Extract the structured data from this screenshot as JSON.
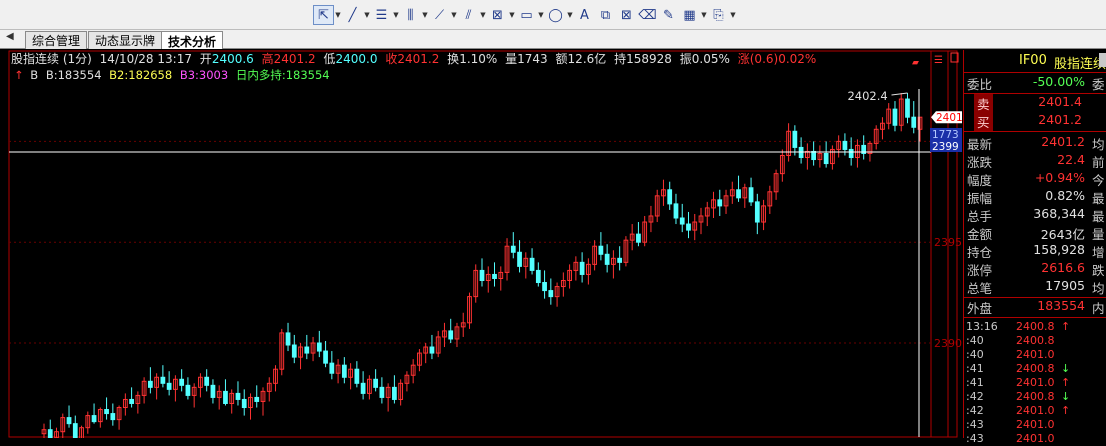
{
  "toolbar": {
    "icons": [
      "cursor-icon",
      "line-icon",
      "text-lines-icon",
      "bar-lines-icon",
      "fan-lines-icon",
      "channel-icon",
      "gann-icon",
      "rectangle-icon",
      "ellipse-icon",
      "text-icon",
      "copy-icon",
      "delete-icon",
      "eraser-icon",
      "note-icon",
      "color-grid-icon",
      "stamp-icon"
    ]
  },
  "tabs": [
    "综合管理",
    "动态显示牌",
    "技术分析"
  ],
  "header": {
    "title": "股指连续",
    "period": "(1分)",
    "datetime": "14/10/28 13:17",
    "open_label": "开",
    "open": "2400.6",
    "high_label": "高",
    "high": "2401.2",
    "low_label": "低",
    "low": "2400.0",
    "close_label": "收",
    "close": "2401.2",
    "turnover_label": "换",
    "turnover": "1.10%",
    "volume_label": "量",
    "volume": "1743",
    "amount_label": "额",
    "amount": "12.6亿",
    "holding_label": "持",
    "holding": "158928",
    "amplitude_label": "振",
    "amplitude": "0.05%",
    "change_label": "涨",
    "change": "(0.6)0.02%"
  },
  "indicator": {
    "arrow": "↑",
    "b_label": "B",
    "b": "B:183554",
    "b2": "B2:182658",
    "b3": "B3:3003",
    "intraday": "日内多持:183554"
  },
  "chart_data": {
    "type": "candlestick",
    "title": "股指连续 (1分)",
    "y_ticks": [
      "2395",
      "2390"
    ],
    "max_label": "2402.4",
    "right_markers": [
      "2401",
      "1773",
      "2399"
    ],
    "up_color": "#ff3232",
    "down_color": "#54ffff",
    "candles": [
      [
        2385.5,
        2386.0,
        2384.8,
        2385.7
      ],
      [
        2385.7,
        2386.2,
        2385.1,
        2385.3
      ],
      [
        2385.3,
        2385.8,
        2384.9,
        2385.6
      ],
      [
        2385.6,
        2386.5,
        2385.2,
        2386.3
      ],
      [
        2386.3,
        2386.9,
        2385.8,
        2386.0
      ],
      [
        2386.0,
        2386.4,
        2385.0,
        2385.2
      ],
      [
        2385.2,
        2385.9,
        2384.8,
        2385.8
      ],
      [
        2385.8,
        2386.6,
        2385.5,
        2386.4
      ],
      [
        2386.4,
        2387.0,
        2386.0,
        2386.1
      ],
      [
        2386.1,
        2386.8,
        2385.8,
        2386.7
      ],
      [
        2386.7,
        2387.3,
        2386.2,
        2386.5
      ],
      [
        2386.5,
        2387.0,
        2385.9,
        2386.2
      ],
      [
        2386.2,
        2386.9,
        2385.7,
        2386.8
      ],
      [
        2386.8,
        2387.5,
        2386.4,
        2387.2
      ],
      [
        2387.2,
        2387.8,
        2386.8,
        2387.0
      ],
      [
        2387.0,
        2387.6,
        2386.5,
        2387.4
      ],
      [
        2387.4,
        2388.3,
        2387.0,
        2388.1
      ],
      [
        2388.1,
        2388.8,
        2387.5,
        2387.8
      ],
      [
        2387.8,
        2388.5,
        2387.2,
        2388.3
      ],
      [
        2388.3,
        2388.9,
        2387.8,
        2388.0
      ],
      [
        2388.0,
        2388.6,
        2387.4,
        2387.7
      ],
      [
        2387.7,
        2388.4,
        2387.1,
        2388.2
      ],
      [
        2388.2,
        2388.7,
        2387.6,
        2387.9
      ],
      [
        2387.9,
        2388.3,
        2387.2,
        2387.4
      ],
      [
        2387.4,
        2388.0,
        2386.8,
        2387.8
      ],
      [
        2387.8,
        2388.5,
        2387.3,
        2388.3
      ],
      [
        2388.3,
        2388.7,
        2387.6,
        2387.9
      ],
      [
        2387.9,
        2388.2,
        2387.0,
        2387.3
      ],
      [
        2387.3,
        2387.9,
        2386.7,
        2387.6
      ],
      [
        2387.6,
        2388.2,
        2386.9,
        2387.0
      ],
      [
        2387.0,
        2387.7,
        2386.5,
        2387.5
      ],
      [
        2387.5,
        2388.1,
        2386.9,
        2387.2
      ],
      [
        2387.2,
        2387.7,
        2386.4,
        2386.8
      ],
      [
        2386.8,
        2387.5,
        2386.2,
        2387.3
      ],
      [
        2387.3,
        2387.9,
        2386.8,
        2387.1
      ],
      [
        2387.1,
        2387.8,
        2386.4,
        2387.6
      ],
      [
        2387.6,
        2388.3,
        2387.1,
        2388.0
      ],
      [
        2388.0,
        2388.9,
        2387.6,
        2388.7
      ],
      [
        2388.7,
        2390.7,
        2388.4,
        2390.5
      ],
      [
        2390.5,
        2391.0,
        2389.6,
        2389.9
      ],
      [
        2389.9,
        2390.4,
        2389.0,
        2389.3
      ],
      [
        2389.3,
        2390.0,
        2388.7,
        2389.8
      ],
      [
        2389.8,
        2390.4,
        2389.2,
        2389.5
      ],
      [
        2389.5,
        2390.3,
        2389.1,
        2390.0
      ],
      [
        2390.0,
        2390.6,
        2389.3,
        2389.6
      ],
      [
        2389.6,
        2390.1,
        2388.8,
        2389.0
      ],
      [
        2389.0,
        2389.6,
        2388.2,
        2388.5
      ],
      [
        2388.5,
        2389.2,
        2388.0,
        2388.9
      ],
      [
        2388.9,
        2389.3,
        2388.0,
        2388.3
      ],
      [
        2388.3,
        2389.0,
        2387.7,
        2388.7
      ],
      [
        2388.7,
        2389.1,
        2387.8,
        2388.0
      ],
      [
        2388.0,
        2388.6,
        2387.2,
        2387.5
      ],
      [
        2387.5,
        2388.4,
        2387.2,
        2388.2
      ],
      [
        2388.2,
        2388.7,
        2387.6,
        2387.8
      ],
      [
        2387.8,
        2388.3,
        2387.0,
        2387.3
      ],
      [
        2387.3,
        2388.0,
        2386.6,
        2387.8
      ],
      [
        2387.8,
        2388.4,
        2387.0,
        2387.2
      ],
      [
        2387.2,
        2388.2,
        2386.9,
        2388.0
      ],
      [
        2388.0,
        2388.6,
        2387.6,
        2388.4
      ],
      [
        2388.4,
        2389.2,
        2388.0,
        2388.9
      ],
      [
        2388.9,
        2389.7,
        2388.6,
        2389.5
      ],
      [
        2389.5,
        2390.0,
        2389.0,
        2389.8
      ],
      [
        2389.8,
        2390.4,
        2389.2,
        2389.5
      ],
      [
        2389.5,
        2390.6,
        2389.3,
        2390.3
      ],
      [
        2390.3,
        2391.0,
        2389.8,
        2390.6
      ],
      [
        2390.6,
        2391.2,
        2390.0,
        2390.2
      ],
      [
        2390.2,
        2391.0,
        2389.8,
        2390.8
      ],
      [
        2390.8,
        2391.5,
        2390.3,
        2391.0
      ],
      [
        2391.0,
        2392.5,
        2390.7,
        2392.3
      ],
      [
        2392.3,
        2393.9,
        2392.0,
        2393.6
      ],
      [
        2393.6,
        2394.2,
        2392.8,
        2393.1
      ],
      [
        2393.1,
        2393.8,
        2392.5,
        2393.4
      ],
      [
        2393.4,
        2394.0,
        2392.8,
        2393.2
      ],
      [
        2393.2,
        2393.8,
        2392.6,
        2393.5
      ],
      [
        2393.5,
        2395.2,
        2393.1,
        2394.8
      ],
      [
        2394.8,
        2395.5,
        2394.2,
        2394.5
      ],
      [
        2394.5,
        2395.1,
        2393.5,
        2393.8
      ],
      [
        2393.8,
        2394.5,
        2393.2,
        2394.2
      ],
      [
        2394.2,
        2394.7,
        2393.4,
        2393.6
      ],
      [
        2393.6,
        2394.0,
        2392.8,
        2393.0
      ],
      [
        2393.0,
        2393.6,
        2392.2,
        2392.6
      ],
      [
        2392.6,
        2393.2,
        2391.9,
        2392.3
      ],
      [
        2392.3,
        2393.0,
        2391.8,
        2392.8
      ],
      [
        2392.8,
        2393.5,
        2392.3,
        2393.1
      ],
      [
        2393.1,
        2393.9,
        2392.7,
        2393.6
      ],
      [
        2393.6,
        2394.3,
        2393.1,
        2394.0
      ],
      [
        2394.0,
        2394.5,
        2393.0,
        2393.4
      ],
      [
        2393.4,
        2394.2,
        2392.9,
        2393.9
      ],
      [
        2393.9,
        2395.1,
        2393.6,
        2394.8
      ],
      [
        2394.8,
        2395.5,
        2394.1,
        2394.4
      ],
      [
        2394.4,
        2394.9,
        2393.5,
        2393.9
      ],
      [
        2393.9,
        2394.6,
        2393.2,
        2394.2
      ],
      [
        2394.2,
        2394.8,
        2393.6,
        2394.0
      ],
      [
        2394.0,
        2395.3,
        2393.8,
        2395.1
      ],
      [
        2395.1,
        2395.9,
        2394.6,
        2395.4
      ],
      [
        2395.4,
        2396.0,
        2394.8,
        2395.0
      ],
      [
        2395.0,
        2396.3,
        2394.8,
        2396.0
      ],
      [
        2396.0,
        2396.8,
        2395.5,
        2396.3
      ],
      [
        2396.3,
        2397.6,
        2396.0,
        2397.3
      ],
      [
        2397.3,
        2398.1,
        2396.8,
        2397.6
      ],
      [
        2397.6,
        2398.0,
        2396.6,
        2396.9
      ],
      [
        2396.9,
        2397.4,
        2395.9,
        2396.2
      ],
      [
        2396.2,
        2396.9,
        2395.5,
        2395.9
      ],
      [
        2395.9,
        2396.5,
        2395.2,
        2395.6
      ],
      [
        2395.6,
        2396.4,
        2395.1,
        2396.0
      ],
      [
        2396.0,
        2396.7,
        2395.4,
        2396.3
      ],
      [
        2396.3,
        2397.0,
        2395.8,
        2396.7
      ],
      [
        2396.7,
        2397.5,
        2396.2,
        2397.1
      ],
      [
        2397.1,
        2397.6,
        2396.3,
        2396.8
      ],
      [
        2396.8,
        2397.6,
        2396.4,
        2397.3
      ],
      [
        2397.3,
        2398.0,
        2396.9,
        2397.6
      ],
      [
        2397.6,
        2398.3,
        2397.0,
        2397.2
      ],
      [
        2397.2,
        2397.9,
        2396.7,
        2397.7
      ],
      [
        2397.7,
        2398.2,
        2396.8,
        2397.0
      ],
      [
        2397.0,
        2397.4,
        2395.4,
        2396.0
      ],
      [
        2396.0,
        2397.1,
        2395.6,
        2396.8
      ],
      [
        2396.8,
        2397.8,
        2396.4,
        2397.5
      ],
      [
        2397.5,
        2398.6,
        2397.1,
        2398.4
      ],
      [
        2398.4,
        2399.6,
        2398.0,
        2399.3
      ],
      [
        2399.3,
        2400.9,
        2399.0,
        2400.5
      ],
      [
        2400.5,
        2400.8,
        2399.3,
        2399.7
      ],
      [
        2399.7,
        2400.2,
        2398.9,
        2399.2
      ],
      [
        2399.2,
        2399.9,
        2398.6,
        2399.5
      ],
      [
        2399.5,
        2400.0,
        2398.8,
        2399.1
      ],
      [
        2399.1,
        2399.8,
        2398.7,
        2399.4
      ],
      [
        2399.4,
        2400.0,
        2398.7,
        2398.9
      ],
      [
        2398.9,
        2399.8,
        2398.6,
        2399.6
      ],
      [
        2399.6,
        2400.3,
        2399.2,
        2400.0
      ],
      [
        2400.0,
        2400.4,
        2399.3,
        2399.6
      ],
      [
        2399.6,
        2400.2,
        2398.8,
        2399.2
      ],
      [
        2399.2,
        2400.1,
        2398.7,
        2399.8
      ],
      [
        2399.8,
        2400.3,
        2399.1,
        2399.4
      ],
      [
        2399.4,
        2400.0,
        2399.0,
        2399.9
      ],
      [
        2399.9,
        2400.8,
        2399.6,
        2400.6
      ],
      [
        2400.6,
        2401.2,
        2400.1,
        2400.9
      ],
      [
        2400.9,
        2401.9,
        2400.6,
        2401.6
      ],
      [
        2401.6,
        2402.0,
        2400.5,
        2400.8
      ],
      [
        2400.8,
        2402.4,
        2400.5,
        2402.1
      ],
      [
        2402.1,
        2402.4,
        2400.9,
        2401.2
      ],
      [
        2401.2,
        2402.0,
        2400.4,
        2400.7
      ],
      [
        2400.6,
        2401.2,
        2400.0,
        2401.2
      ]
    ]
  },
  "panel": {
    "code": "IF00",
    "name": "股指连续",
    "rows": [
      {
        "label": "委比",
        "value": "-50.00%",
        "extra": "委",
        "color": "#54ff54"
      },
      {
        "label": "卖",
        "value": "2401.4",
        "extra": "",
        "color": "#ff3232",
        "boxed": true
      },
      {
        "label": "买",
        "value": "2401.2",
        "extra": "",
        "color": "#ff3232",
        "boxed": true
      },
      {
        "label": "最新",
        "value": "2401.2",
        "extra": "均",
        "color": "#ff3232"
      },
      {
        "label": "涨跌",
        "value": "22.4",
        "extra": "前",
        "color": "#ff3232"
      },
      {
        "label": "幅度",
        "value": "+0.94%",
        "extra": "今",
        "color": "#ff3232"
      },
      {
        "label": "振幅",
        "value": "0.82%",
        "extra": "最",
        "color": "#e0e0e0"
      },
      {
        "label": "总手",
        "value": "368,344",
        "extra": "最",
        "color": "#e0e0e0"
      },
      {
        "label": "金额",
        "value": "2643亿",
        "extra": "量",
        "color": "#e0e0e0"
      },
      {
        "label": "持仓",
        "value": "158,928",
        "extra": "增",
        "color": "#e0e0e0"
      },
      {
        "label": "涨停",
        "value": "2616.6",
        "extra": "跌",
        "color": "#ff3232"
      },
      {
        "label": "总笔",
        "value": "17905",
        "extra": "均",
        "color": "#e0e0e0"
      },
      {
        "label": "外盘",
        "value": "183554",
        "extra": "内",
        "color": "#ff3232"
      }
    ],
    "ticks": [
      {
        "time": "13:16",
        "price": "2400.8",
        "arrow": "↑",
        "arrow_color": "#ff3232"
      },
      {
        "time": ":40",
        "price": "2400.8",
        "arrow": "",
        "arrow_color": "#ff3232"
      },
      {
        "time": ":40",
        "price": "2401.0",
        "arrow": "",
        "arrow_color": "#ff3232"
      },
      {
        "time": ":41",
        "price": "2400.8",
        "arrow": "↓",
        "arrow_color": "#54ff54"
      },
      {
        "time": ":41",
        "price": "2401.0",
        "arrow": "↑",
        "arrow_color": "#ff3232"
      },
      {
        "time": ":42",
        "price": "2400.8",
        "arrow": "↓",
        "arrow_color": "#54ff54"
      },
      {
        "time": ":42",
        "price": "2401.0",
        "arrow": "↑",
        "arrow_color": "#ff3232"
      },
      {
        "time": ":43",
        "price": "2401.0",
        "arrow": "",
        "arrow_color": "#ff3232"
      },
      {
        "time": ":43",
        "price": "2401.0",
        "arrow": "",
        "arrow_color": "#ff3232"
      }
    ]
  }
}
